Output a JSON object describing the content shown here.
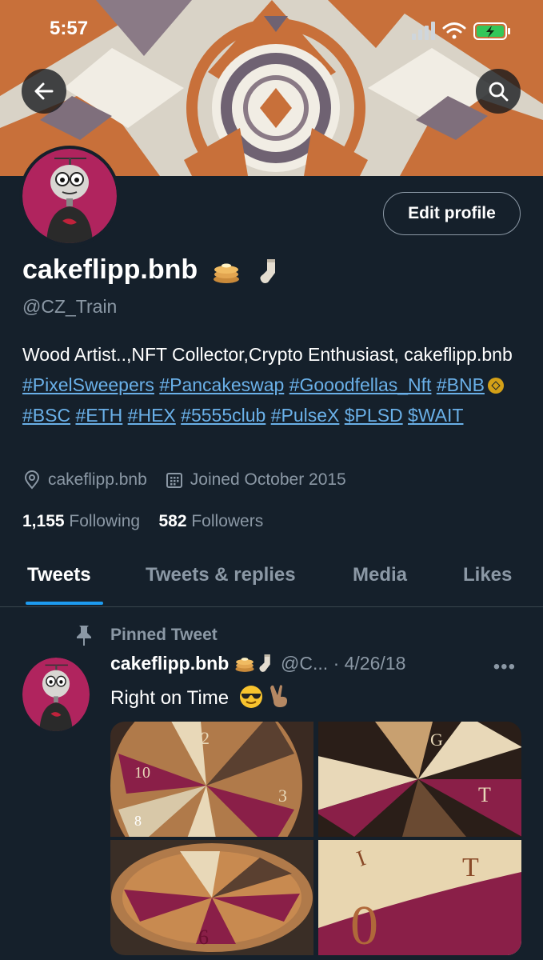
{
  "status_bar": {
    "time": "5:57"
  },
  "profile": {
    "edit_label": "Edit profile",
    "display_name": "cakeflipp.bnb",
    "handle": "@CZ_Train",
    "bio_text": "Wood Artist..,NFT Collector,Crypto Enthusiast, cakeflipp.bnb",
    "bio_tags": [
      "#PixelSweepers",
      "#Pancakeswap",
      "#Gooodfellas_Nft",
      "#BNB",
      "#BSC",
      "#ETH",
      "#HEX",
      "#5555club",
      "#PulseX",
      "$PLSD",
      "$WAIT"
    ],
    "location": "cakeflipp.bnb",
    "joined": "Joined October 2015",
    "following_count": "1,155",
    "following_label": "Following",
    "followers_count": "582",
    "followers_label": "Followers"
  },
  "tabs": [
    {
      "label": "Tweets",
      "active": true
    },
    {
      "label": "Tweets & replies",
      "active": false
    },
    {
      "label": "Media",
      "active": false
    },
    {
      "label": "Likes",
      "active": false
    }
  ],
  "pinned_label": "Pinned Tweet",
  "tweet": {
    "author": "cakeflipp.bnb",
    "handle_trunc": "@C...",
    "separator": "·",
    "date": "4/26/18",
    "text": "Right on Time",
    "more": "•••"
  },
  "colors": {
    "background": "#15202b",
    "accent": "#1d9bf0",
    "link": "#6ab0e8",
    "muted": "#8b98a5"
  },
  "icons": [
    "back-arrow-icon",
    "search-icon",
    "location-pin-icon",
    "calendar-icon",
    "pin-icon",
    "more-icon",
    "pancake-emoji-icon",
    "sock-emoji-icon",
    "sunglasses-emoji-icon",
    "victory-hand-emoji-icon"
  ]
}
